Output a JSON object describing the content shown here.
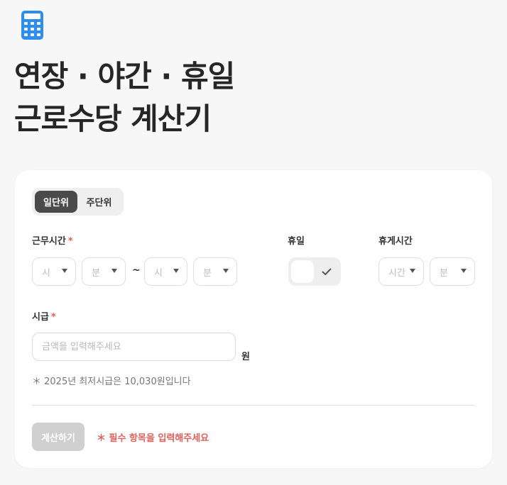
{
  "app_icon": "calculator-icon",
  "colors": {
    "accent_blue": "#2f8cf0",
    "required_red": "#e0605a",
    "segment_active": "#4a4a4a",
    "button_disabled": "#d0d0d0"
  },
  "title": {
    "line1": "연장 · 야간 · 휴일",
    "line2": "근로수당 계산기"
  },
  "mode_tabs": {
    "daily": "일단위",
    "weekly": "주단위",
    "selected": "일단위"
  },
  "work_time": {
    "label": "근무시간",
    "required_mark": "*",
    "start_hour": "시",
    "start_minute": "분",
    "separator": "~",
    "end_hour": "시",
    "end_minute": "분"
  },
  "holiday": {
    "label": "휴일",
    "checked": false
  },
  "break_time": {
    "label": "휴게시간",
    "hour": "시간",
    "minute": "분"
  },
  "wage": {
    "label": "시급",
    "required_mark": "*",
    "placeholder": "금액을 입력해주세요",
    "unit": "원",
    "note": "＊ 2025년 최저시급은 10,030원입니다"
  },
  "footer": {
    "calculate_label": "계산하기",
    "warning": "＊ 필수 항목을 입력해주세요"
  }
}
